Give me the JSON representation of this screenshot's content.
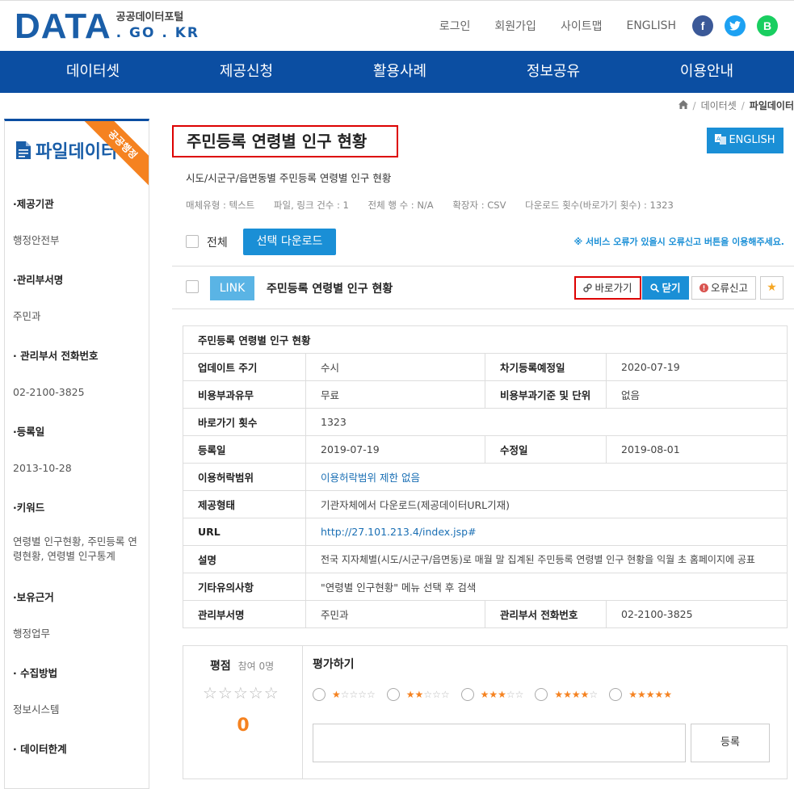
{
  "header": {
    "logo_main": "DATA",
    "logo_korean": "공공데이터포털",
    "logo_domain": ". GO . KR",
    "top_links": [
      "로그인",
      "회원가입",
      "사이트맵",
      "ENGLISH"
    ],
    "social": {
      "facebook": "f",
      "twitter": "t",
      "blog": "B"
    }
  },
  "nav": [
    "데이터셋",
    "제공신청",
    "활용사례",
    "정보공유",
    "이용안내"
  ],
  "breadcrumb": {
    "items": [
      "데이터셋",
      "파일데이터"
    ],
    "separator": "/"
  },
  "sidebar": {
    "title": "파일데이터",
    "ribbon": "공공행정",
    "items": [
      {
        "label": "·제공기관",
        "value": "행정안전부"
      },
      {
        "label": "·관리부서명",
        "value": "주민과"
      },
      {
        "label": "· 관리부서 전화번호",
        "value": "02-2100-3825"
      },
      {
        "label": "·등록일",
        "value": "2013-10-28"
      },
      {
        "label": "·키워드",
        "value": "연령별 인구현황, 주민등록 연령현황, 연령별 인구통계"
      },
      {
        "label": "·보유근거",
        "value": "행정업무"
      },
      {
        "label": "· 수집방법",
        "value": "정보시스템"
      },
      {
        "label": "· 데이터한계",
        "value": ""
      }
    ]
  },
  "main": {
    "title": "주민등록 연령별 인구 현황",
    "english_button": "ENGLISH",
    "subtitle": "시도/시군구/읍면동별 주민등록 연령별 인구 현황",
    "meta": [
      "매체유형 : 텍스트",
      "파일, 링크 건수 : 1",
      "전체 행 수 : N/A",
      "확장자 : CSV",
      "다운로드 횟수(바로가기 횟수) : 1323"
    ],
    "select_all_label": "전체",
    "select_download": "선택 다운로드",
    "notice": "※ 서비스 오류가 있을시 오류신고 버튼을 이용해주세요.",
    "file_row": {
      "tag": "LINK",
      "title": "주민등록 연령별 인구 현황",
      "go_button": "바로가기",
      "close_button": "닫기",
      "error_button": "오류신고",
      "star": "★"
    },
    "detail": {
      "header": "주민등록 연령별 인구 현황",
      "rows": [
        {
          "k1": "업데이트 주기",
          "v1": "수시",
          "k2": "차기등록예정일",
          "v2": "2020-07-19"
        },
        {
          "k1": "비용부과유무",
          "v1": "무료",
          "k2": "비용부과기준 및 단위",
          "v2": "없음"
        },
        {
          "k1": "바로가기 횟수",
          "v1": "1323"
        },
        {
          "k1": "등록일",
          "v1": "2019-07-19",
          "k2": "수정일",
          "v2": "2019-08-01"
        },
        {
          "k1": "이용허락범위",
          "v1": "이용허락범위 제한 없음"
        },
        {
          "k1": "제공형태",
          "v1": "기관자체에서 다운로드(제공데이터URL기재)"
        },
        {
          "k1": "URL",
          "v1": "http://27.101.213.4/index.jsp#"
        },
        {
          "k1": "설명",
          "v1": "전국 지자체별(시도/시군구/읍면동)로 매월 말 집계된 주민등록 연령별 인구 현황을 익월 초 홈페이지에 공표"
        },
        {
          "k1": "기타유의사항",
          "v1": "\"연령별 인구현황\" 메뉴 선택 후 검색"
        },
        {
          "k1": "관리부서명",
          "v1": "주민과",
          "k2": "관리부서 전화번호",
          "v2": "02-2100-3825"
        }
      ]
    },
    "rating": {
      "score_label": "평점",
      "participants": "참여 0명",
      "empty_stars": "☆☆☆☆☆",
      "score": "0",
      "eval_title": "평가하기",
      "options": [
        1,
        2,
        3,
        4,
        5
      ],
      "register_button": "등록"
    }
  },
  "colors": {
    "brand_blue": "#0b4ea2",
    "accent_blue": "#1a8fd6",
    "orange": "#f58220",
    "red_highlight": "#dd0000"
  }
}
